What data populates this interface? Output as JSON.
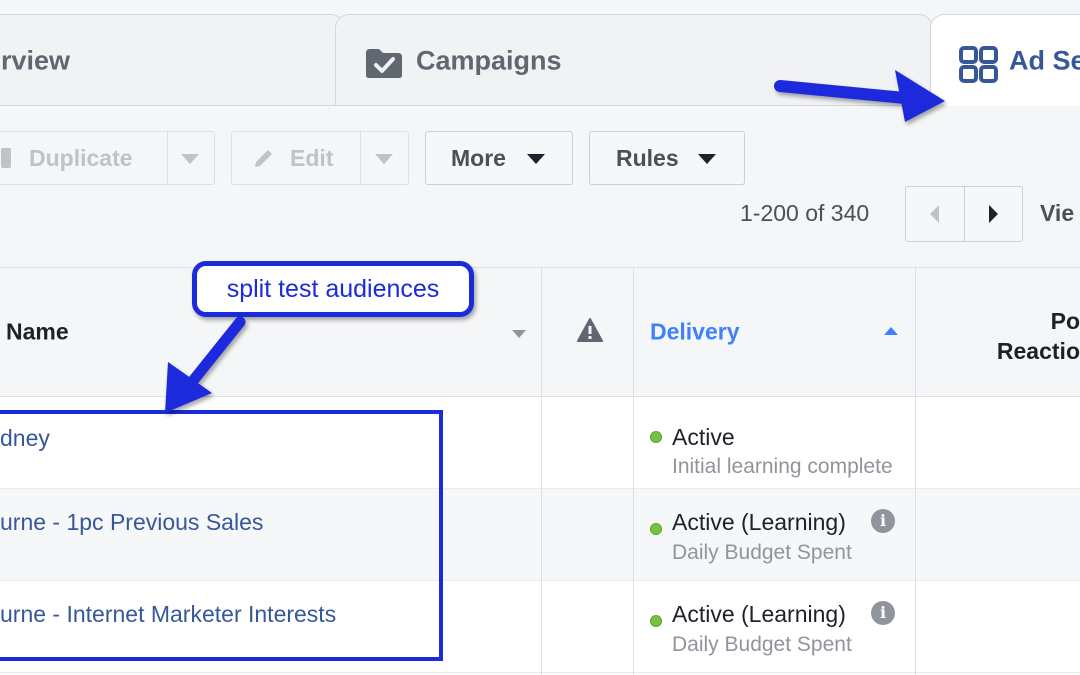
{
  "tabs": [
    {
      "label": "rview",
      "icon": "none"
    },
    {
      "label": "Campaigns",
      "icon": "folder-check-icon"
    },
    {
      "label": "Ad Se",
      "icon": "grid-icon"
    }
  ],
  "toolbar": {
    "duplicate_label": "Duplicate",
    "edit_label": "Edit",
    "more_label": "More",
    "rules_label": "Rules"
  },
  "pagination": {
    "range_text": "1-200 of 340",
    "view_text": "Vie"
  },
  "table": {
    "columns": {
      "name": "Name",
      "delivery": "Delivery",
      "reach_line1": "Po",
      "reach_line2": "Reactio"
    },
    "rows": [
      {
        "name": "dney",
        "status": "Active",
        "substatus": "Initial learning complete",
        "info": false
      },
      {
        "name": "urne - 1pc Previous Sales",
        "status": "Active (Learning)",
        "substatus": "Daily Budget Spent",
        "info": true
      },
      {
        "name": "urne - Internet Marketer Interests",
        "status": "Active (Learning)",
        "substatus": "Daily Budget Spent",
        "info": true
      }
    ]
  },
  "annotation": {
    "callout_text": "split test audiences",
    "color": "#1a2bdb"
  },
  "colors": {
    "link": "#365899",
    "accent": "#4080ff",
    "active_dot": "#7ac143"
  }
}
